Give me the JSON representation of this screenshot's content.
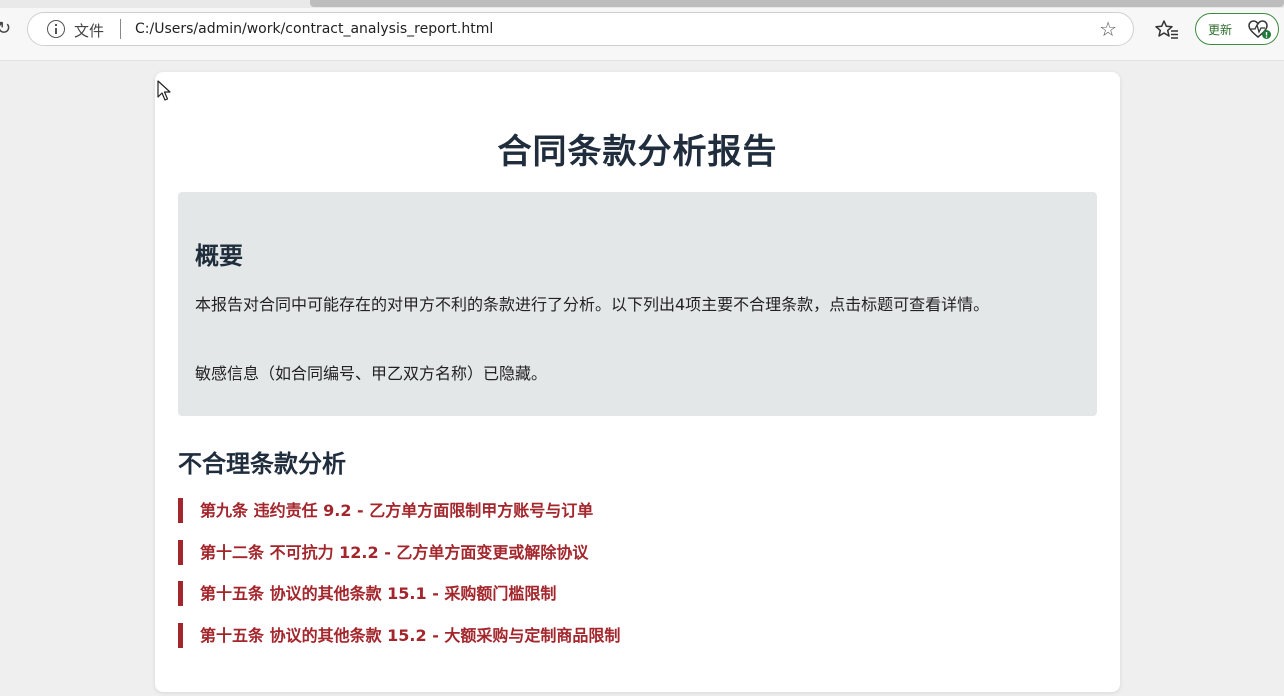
{
  "browser": {
    "file_label": "文件",
    "url": "C:/Users/admin/work/contract_analysis_report.html",
    "update_label": "更新"
  },
  "report": {
    "title": "合同条款分析报告",
    "summary": {
      "heading": "概要",
      "paragraph_1": "本报告对合同中可能存在的对甲方不利的条款进行了分析。以下列出4项主要不合理条款，点击标题可查看详情。",
      "paragraph_2": "敏感信息（如合同编号、甲乙双方名称）已隐藏。"
    },
    "clauses_section": {
      "heading": "不合理条款分析",
      "items": [
        {
          "label": "第九条 违约责任 9.2 - 乙方单方面限制甲方账号与订单"
        },
        {
          "label": "第十二条 不可抗力 12.2 - 乙方单方面变更或解除协议"
        },
        {
          "label": "第十五条 协议的其他条款 15.1 - 采购额门槛限制"
        },
        {
          "label": "第十五条 协议的其他条款 15.2 - 大额采购与定制商品限制"
        }
      ]
    }
  },
  "icons": {
    "info": "info-icon",
    "star": "star-icon",
    "favorites": "favorites-icon",
    "update": "heart-pulse-icon",
    "cursor": "mouse-cursor-icon"
  },
  "colors": {
    "clause_accent": "#a3262c",
    "title_text": "#1f2d3d",
    "summary_background": "#e4e7e8",
    "update_border": "#3d8b3d"
  }
}
